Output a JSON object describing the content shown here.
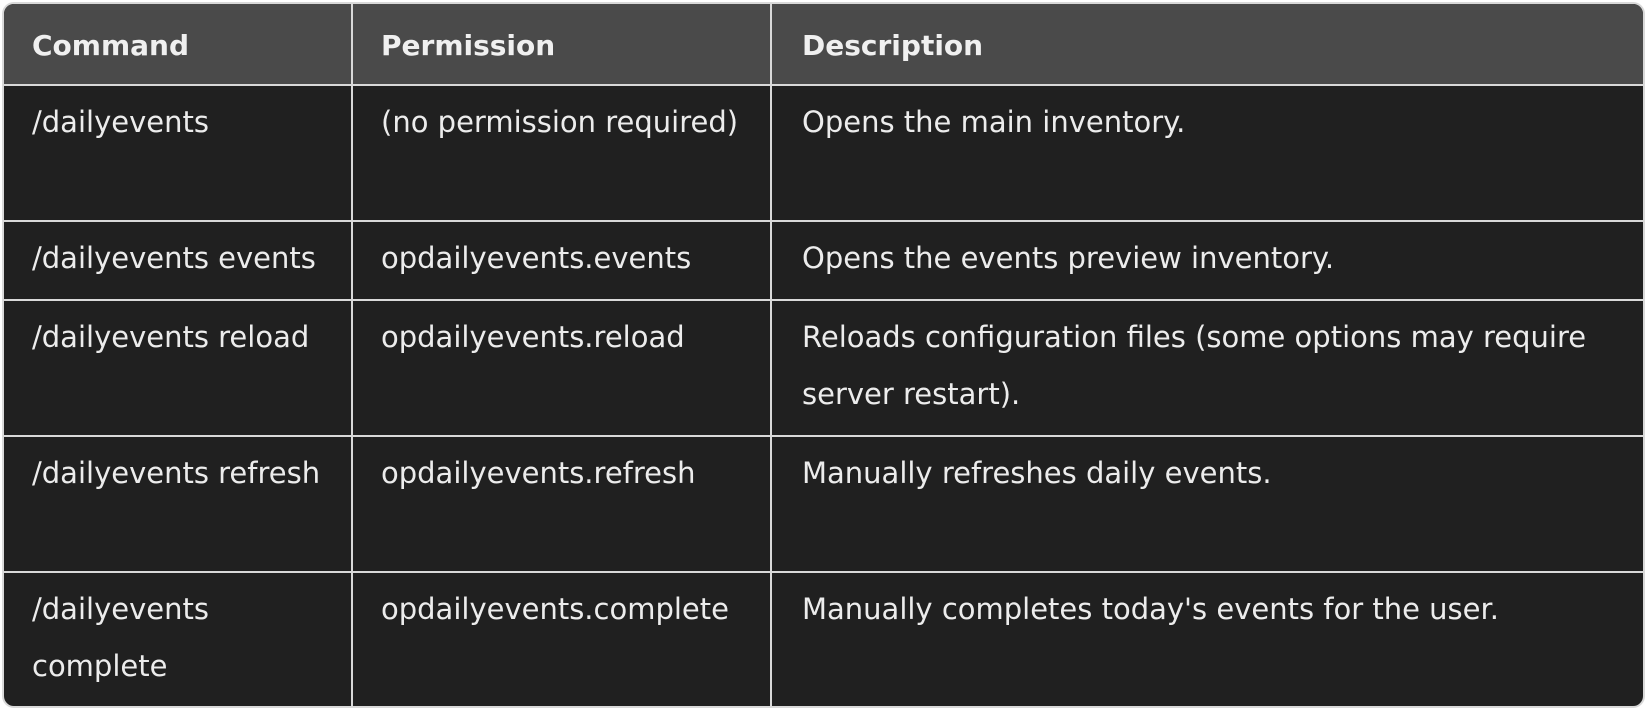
{
  "table": {
    "headers": [
      "Command",
      "Permission",
      "Description"
    ],
    "rows": [
      [
        "/dailyevents",
        "(no permission required)",
        "Opens the main inventory."
      ],
      [
        "/dailyevents events",
        "opdailyevents.events",
        "Opens the events preview inventory."
      ],
      [
        "/dailyevents reload",
        "opdailyevents.reload",
        "Reloads configuration files (some options may require server restart)."
      ],
      [
        "/dailyevents refresh",
        "opdailyevents.refresh",
        "Manually refreshes daily events."
      ],
      [
        "/dailyevents complete",
        "opdailyevents.complete",
        "Manually completes today's events for the user."
      ]
    ]
  },
  "colors": {
    "header_bg": "#4a4a4a",
    "body_bg": "#202020",
    "border": "#d9d9d9",
    "text": "#ececec"
  }
}
